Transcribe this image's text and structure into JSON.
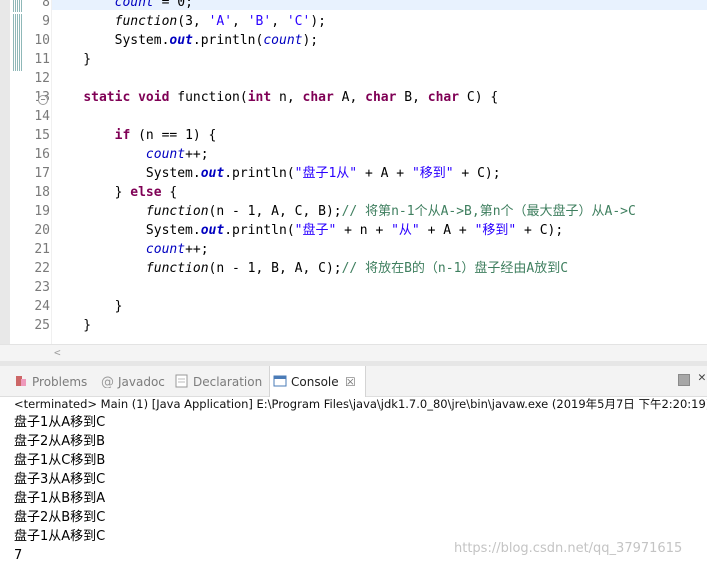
{
  "editor": {
    "line_numbers": [
      "8",
      "9",
      "10",
      "11",
      "12",
      "13",
      "14",
      "15",
      "16",
      "17",
      "18",
      "19",
      "20",
      "21",
      "22",
      "23",
      "24",
      "25"
    ],
    "lines": [
      [
        {
          "t": "        "
        },
        {
          "t": "count",
          "c": "fld"
        },
        {
          "t": " = 0;"
        }
      ],
      [
        {
          "t": "        "
        },
        {
          "t": "function",
          "c": "it"
        },
        {
          "t": "(3, "
        },
        {
          "t": "'A'",
          "c": "str"
        },
        {
          "t": ", "
        },
        {
          "t": "'B'",
          "c": "str"
        },
        {
          "t": ", "
        },
        {
          "t": "'C'",
          "c": "str"
        },
        {
          "t": ");"
        }
      ],
      [
        {
          "t": "        System."
        },
        {
          "t": "out",
          "c": "st"
        },
        {
          "t": ".println("
        },
        {
          "t": "count",
          "c": "fld"
        },
        {
          "t": ");"
        }
      ],
      [
        {
          "t": "    }"
        }
      ],
      [
        {
          "t": ""
        }
      ],
      [
        {
          "t": "    "
        },
        {
          "t": "static",
          "c": "kw"
        },
        {
          "t": " "
        },
        {
          "t": "void",
          "c": "kw"
        },
        {
          "t": " function("
        },
        {
          "t": "int",
          "c": "kw"
        },
        {
          "t": " n, "
        },
        {
          "t": "char",
          "c": "kw"
        },
        {
          "t": " A, "
        },
        {
          "t": "char",
          "c": "kw"
        },
        {
          "t": " B, "
        },
        {
          "t": "char",
          "c": "kw"
        },
        {
          "t": " C) {"
        }
      ],
      [
        {
          "t": ""
        }
      ],
      [
        {
          "t": "        "
        },
        {
          "t": "if",
          "c": "kw"
        },
        {
          "t": " (n == 1) {"
        }
      ],
      [
        {
          "t": "            "
        },
        {
          "t": "count",
          "c": "fld"
        },
        {
          "t": "++;"
        }
      ],
      [
        {
          "t": "            System."
        },
        {
          "t": "out",
          "c": "st"
        },
        {
          "t": ".println("
        },
        {
          "t": "\"盘子1从\"",
          "c": "str"
        },
        {
          "t": " + A + "
        },
        {
          "t": "\"移到\"",
          "c": "str"
        },
        {
          "t": " + C);"
        }
      ],
      [
        {
          "t": "        } "
        },
        {
          "t": "else",
          "c": "kw"
        },
        {
          "t": " {"
        }
      ],
      [
        {
          "t": "            "
        },
        {
          "t": "function",
          "c": "it"
        },
        {
          "t": "(n - 1, A, C, B);"
        },
        {
          "t": "// 将第n-1个从A->B,第n个（最大盘子）从A->C",
          "c": "cmt"
        }
      ],
      [
        {
          "t": "            System."
        },
        {
          "t": "out",
          "c": "st"
        },
        {
          "t": ".println("
        },
        {
          "t": "\"盘子\"",
          "c": "str"
        },
        {
          "t": " + n + "
        },
        {
          "t": "\"从\"",
          "c": "str"
        },
        {
          "t": " + A + "
        },
        {
          "t": "\"移到\"",
          "c": "str"
        },
        {
          "t": " + C);"
        }
      ],
      [
        {
          "t": "            "
        },
        {
          "t": "count",
          "c": "fld"
        },
        {
          "t": "++;"
        }
      ],
      [
        {
          "t": "            "
        },
        {
          "t": "function",
          "c": "it"
        },
        {
          "t": "(n - 1, B, A, C);"
        },
        {
          "t": "// 将放在B的（n-1）盘子经由A放到C",
          "c": "cmt"
        }
      ],
      [
        {
          "t": ""
        }
      ],
      [
        {
          "t": "        }"
        }
      ],
      [
        {
          "t": "    }"
        }
      ]
    ]
  },
  "tabs": [
    {
      "label": "Problems",
      "icon": "problems-icon"
    },
    {
      "label": "Javadoc",
      "icon": "javadoc-icon"
    },
    {
      "label": "Declaration",
      "icon": "declaration-icon"
    },
    {
      "label": "Console",
      "icon": "console-icon",
      "active": true
    }
  ],
  "console": {
    "header": "<terminated> Main (1) [Java Application] E:\\Program Files\\java\\jdk1.7.0_80\\jre\\bin\\javaw.exe (2019年5月7日 下午2:20:19)",
    "output": [
      "盘子1从A移到C",
      "盘子2从A移到B",
      "盘子1从C移到B",
      "盘子3从A移到C",
      "盘子1从B移到A",
      "盘子2从B移到C",
      "盘子1从A移到C",
      "7"
    ]
  },
  "watermark": "https://blog.csdn.net/qq_37971615",
  "colors": {
    "keyword": "#7f0055",
    "field": "#0000c0",
    "string": "#2a00ff",
    "comment": "#3f7f5f"
  }
}
